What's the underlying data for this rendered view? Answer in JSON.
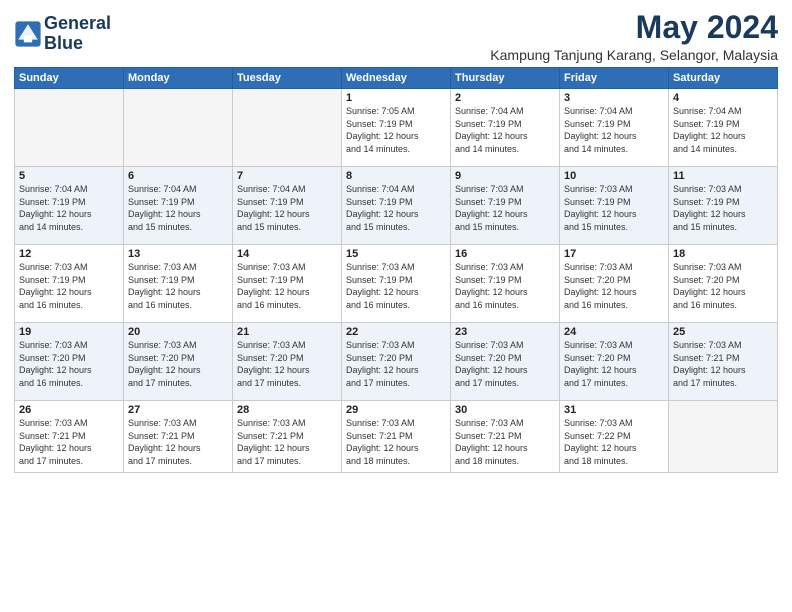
{
  "logo": {
    "line1": "General",
    "line2": "Blue"
  },
  "title": "May 2024",
  "location": "Kampung Tanjung Karang, Selangor, Malaysia",
  "weekdays": [
    "Sunday",
    "Monday",
    "Tuesday",
    "Wednesday",
    "Thursday",
    "Friday",
    "Saturday"
  ],
  "weeks": [
    [
      {
        "day": "",
        "info": ""
      },
      {
        "day": "",
        "info": ""
      },
      {
        "day": "",
        "info": ""
      },
      {
        "day": "1",
        "info": "Sunrise: 7:05 AM\nSunset: 7:19 PM\nDaylight: 12 hours\nand 14 minutes."
      },
      {
        "day": "2",
        "info": "Sunrise: 7:04 AM\nSunset: 7:19 PM\nDaylight: 12 hours\nand 14 minutes."
      },
      {
        "day": "3",
        "info": "Sunrise: 7:04 AM\nSunset: 7:19 PM\nDaylight: 12 hours\nand 14 minutes."
      },
      {
        "day": "4",
        "info": "Sunrise: 7:04 AM\nSunset: 7:19 PM\nDaylight: 12 hours\nand 14 minutes."
      }
    ],
    [
      {
        "day": "5",
        "info": "Sunrise: 7:04 AM\nSunset: 7:19 PM\nDaylight: 12 hours\nand 14 minutes."
      },
      {
        "day": "6",
        "info": "Sunrise: 7:04 AM\nSunset: 7:19 PM\nDaylight: 12 hours\nand 15 minutes."
      },
      {
        "day": "7",
        "info": "Sunrise: 7:04 AM\nSunset: 7:19 PM\nDaylight: 12 hours\nand 15 minutes."
      },
      {
        "day": "8",
        "info": "Sunrise: 7:04 AM\nSunset: 7:19 PM\nDaylight: 12 hours\nand 15 minutes."
      },
      {
        "day": "9",
        "info": "Sunrise: 7:03 AM\nSunset: 7:19 PM\nDaylight: 12 hours\nand 15 minutes."
      },
      {
        "day": "10",
        "info": "Sunrise: 7:03 AM\nSunset: 7:19 PM\nDaylight: 12 hours\nand 15 minutes."
      },
      {
        "day": "11",
        "info": "Sunrise: 7:03 AM\nSunset: 7:19 PM\nDaylight: 12 hours\nand 15 minutes."
      }
    ],
    [
      {
        "day": "12",
        "info": "Sunrise: 7:03 AM\nSunset: 7:19 PM\nDaylight: 12 hours\nand 16 minutes."
      },
      {
        "day": "13",
        "info": "Sunrise: 7:03 AM\nSunset: 7:19 PM\nDaylight: 12 hours\nand 16 minutes."
      },
      {
        "day": "14",
        "info": "Sunrise: 7:03 AM\nSunset: 7:19 PM\nDaylight: 12 hours\nand 16 minutes."
      },
      {
        "day": "15",
        "info": "Sunrise: 7:03 AM\nSunset: 7:19 PM\nDaylight: 12 hours\nand 16 minutes."
      },
      {
        "day": "16",
        "info": "Sunrise: 7:03 AM\nSunset: 7:19 PM\nDaylight: 12 hours\nand 16 minutes."
      },
      {
        "day": "17",
        "info": "Sunrise: 7:03 AM\nSunset: 7:20 PM\nDaylight: 12 hours\nand 16 minutes."
      },
      {
        "day": "18",
        "info": "Sunrise: 7:03 AM\nSunset: 7:20 PM\nDaylight: 12 hours\nand 16 minutes."
      }
    ],
    [
      {
        "day": "19",
        "info": "Sunrise: 7:03 AM\nSunset: 7:20 PM\nDaylight: 12 hours\nand 16 minutes."
      },
      {
        "day": "20",
        "info": "Sunrise: 7:03 AM\nSunset: 7:20 PM\nDaylight: 12 hours\nand 17 minutes."
      },
      {
        "day": "21",
        "info": "Sunrise: 7:03 AM\nSunset: 7:20 PM\nDaylight: 12 hours\nand 17 minutes."
      },
      {
        "day": "22",
        "info": "Sunrise: 7:03 AM\nSunset: 7:20 PM\nDaylight: 12 hours\nand 17 minutes."
      },
      {
        "day": "23",
        "info": "Sunrise: 7:03 AM\nSunset: 7:20 PM\nDaylight: 12 hours\nand 17 minutes."
      },
      {
        "day": "24",
        "info": "Sunrise: 7:03 AM\nSunset: 7:20 PM\nDaylight: 12 hours\nand 17 minutes."
      },
      {
        "day": "25",
        "info": "Sunrise: 7:03 AM\nSunset: 7:21 PM\nDaylight: 12 hours\nand 17 minutes."
      }
    ],
    [
      {
        "day": "26",
        "info": "Sunrise: 7:03 AM\nSunset: 7:21 PM\nDaylight: 12 hours\nand 17 minutes."
      },
      {
        "day": "27",
        "info": "Sunrise: 7:03 AM\nSunset: 7:21 PM\nDaylight: 12 hours\nand 17 minutes."
      },
      {
        "day": "28",
        "info": "Sunrise: 7:03 AM\nSunset: 7:21 PM\nDaylight: 12 hours\nand 17 minutes."
      },
      {
        "day": "29",
        "info": "Sunrise: 7:03 AM\nSunset: 7:21 PM\nDaylight: 12 hours\nand 18 minutes."
      },
      {
        "day": "30",
        "info": "Sunrise: 7:03 AM\nSunset: 7:21 PM\nDaylight: 12 hours\nand 18 minutes."
      },
      {
        "day": "31",
        "info": "Sunrise: 7:03 AM\nSunset: 7:22 PM\nDaylight: 12 hours\nand 18 minutes."
      },
      {
        "day": "",
        "info": ""
      }
    ]
  ]
}
